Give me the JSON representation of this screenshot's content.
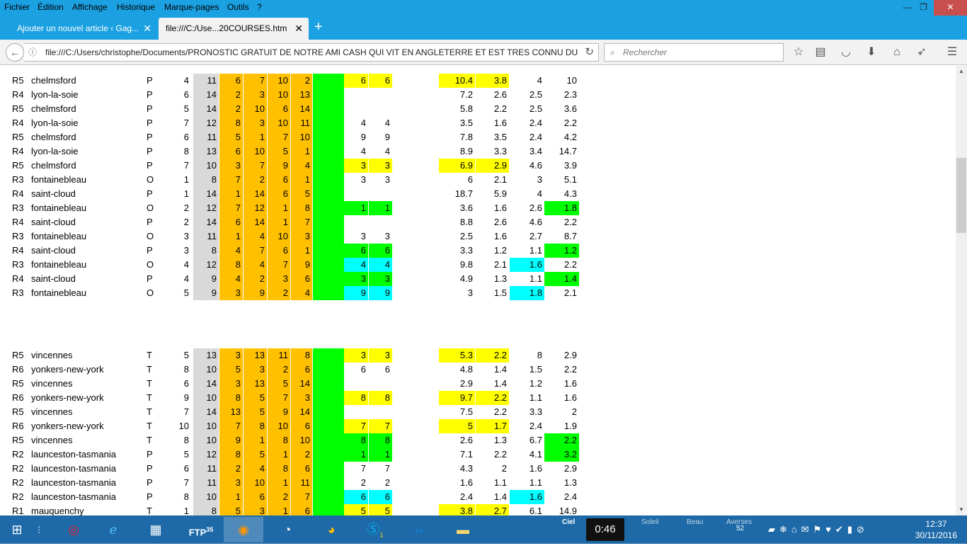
{
  "menubar": {
    "items": [
      "Fichier",
      "Édition",
      "Affichage",
      "Historique",
      "Marque-pages",
      "Outils",
      "?"
    ],
    "minimize": "—",
    "maximize": "❐",
    "close": "✕"
  },
  "tabs": [
    {
      "title": "Ajouter un nouvel article ‹ Gag..."
    },
    {
      "title": "file:///C:/Use...20COURSES.htm"
    }
  ],
  "navbar": {
    "url": "file:///C:/Users/christophe/Documents/PRONOSTIC GRATUIT DE NOTRE AMI CASH QUI VIT EN ANGLETERRE ET EST TRES CONNU DU M",
    "search_placeholder": "Rechercher"
  },
  "colors": {
    "orange": "#ffc000",
    "green": "#00ff00",
    "yellow": "#ffff00",
    "cyan": "#00ffff",
    "gray": "#d9d9d9"
  },
  "table1": [
    {
      "r": "R5",
      "track": "chelmsford",
      "t": "P",
      "a": "4",
      "b": "11",
      "o": [
        "6",
        "7",
        "10",
        "2"
      ],
      "p": [
        "6",
        "6"
      ],
      "pc": "yellow",
      "v": [
        "10.4",
        "3.8",
        "4",
        "10"
      ],
      "vc": [
        "yellow",
        "yellow",
        "",
        ""
      ]
    },
    {
      "r": "R4",
      "track": "lyon-la-soie",
      "t": "P",
      "a": "6",
      "b": "14",
      "o": [
        "2",
        "3",
        "10",
        "13"
      ],
      "p": [
        "",
        ""
      ],
      "pc": "",
      "v": [
        "7.2",
        "2.6",
        "2.5",
        "2.3"
      ],
      "vc": [
        "",
        "",
        "",
        ""
      ]
    },
    {
      "r": "R5",
      "track": "chelmsford",
      "t": "P",
      "a": "5",
      "b": "14",
      "o": [
        "2",
        "10",
        "6",
        "14"
      ],
      "p": [
        "",
        ""
      ],
      "pc": "",
      "v": [
        "5.8",
        "2.2",
        "2.5",
        "3.6"
      ],
      "vc": [
        "",
        "",
        "",
        ""
      ]
    },
    {
      "r": "R4",
      "track": "lyon-la-soie",
      "t": "P",
      "a": "7",
      "b": "12",
      "o": [
        "8",
        "3",
        "10",
        "11"
      ],
      "p": [
        "4",
        "4"
      ],
      "pc": "",
      "v": [
        "3.5",
        "1.6",
        "2.4",
        "2.2"
      ],
      "vc": [
        "",
        "",
        "",
        ""
      ]
    },
    {
      "r": "R5",
      "track": "chelmsford",
      "t": "P",
      "a": "6",
      "b": "11",
      "o": [
        "5",
        "1",
        "7",
        "10"
      ],
      "p": [
        "9",
        "9"
      ],
      "pc": "",
      "v": [
        "7.8",
        "3.5",
        "2.4",
        "4.2"
      ],
      "vc": [
        "",
        "",
        "",
        ""
      ]
    },
    {
      "r": "R4",
      "track": "lyon-la-soie",
      "t": "P",
      "a": "8",
      "b": "13",
      "o": [
        "6",
        "10",
        "5",
        "1"
      ],
      "p": [
        "4",
        "4"
      ],
      "pc": "",
      "v": [
        "8.9",
        "3.3",
        "3.4",
        "14.7"
      ],
      "vc": [
        "",
        "",
        "",
        ""
      ]
    },
    {
      "r": "R5",
      "track": "chelmsford",
      "t": "P",
      "a": "7",
      "b": "10",
      "o": [
        "3",
        "7",
        "9",
        "4"
      ],
      "p": [
        "3",
        "3"
      ],
      "pc": "yellow",
      "v": [
        "6.9",
        "2.9",
        "4.6",
        "3.9"
      ],
      "vc": [
        "yellow",
        "yellow",
        "",
        ""
      ]
    },
    {
      "r": "R3",
      "track": "fontainebleau",
      "t": "O",
      "a": "1",
      "b": "8",
      "o": [
        "7",
        "2",
        "6",
        "1"
      ],
      "p": [
        "3",
        "3"
      ],
      "pc": "",
      "v": [
        "6",
        "2.1",
        "3",
        "5.1"
      ],
      "vc": [
        "",
        "",
        "",
        ""
      ]
    },
    {
      "r": "R4",
      "track": "saint-cloud",
      "t": "P",
      "a": "1",
      "b": "14",
      "o": [
        "1",
        "14",
        "6",
        "5"
      ],
      "p": [
        "",
        ""
      ],
      "pc": "",
      "v": [
        "18.7",
        "5.9",
        "4",
        "4.3"
      ],
      "vc": [
        "",
        "",
        "",
        ""
      ]
    },
    {
      "r": "R3",
      "track": "fontainebleau",
      "t": "O",
      "a": "2",
      "b": "12",
      "o": [
        "7",
        "12",
        "1",
        "8"
      ],
      "p": [
        "1",
        "1"
      ],
      "pc": "green",
      "v": [
        "3.6",
        "1.6",
        "2.6",
        "1.8"
      ],
      "vc": [
        "",
        "",
        "",
        "green"
      ]
    },
    {
      "r": "R4",
      "track": "saint-cloud",
      "t": "P",
      "a": "2",
      "b": "14",
      "o": [
        "6",
        "14",
        "1",
        "7"
      ],
      "p": [
        "",
        ""
      ],
      "pc": "",
      "v": [
        "8.8",
        "2.6",
        "4.6",
        "2.2"
      ],
      "vc": [
        "",
        "",
        "",
        ""
      ]
    },
    {
      "r": "R3",
      "track": "fontainebleau",
      "t": "O",
      "a": "3",
      "b": "11",
      "o": [
        "1",
        "4",
        "10",
        "3"
      ],
      "p": [
        "3",
        "3"
      ],
      "pc": "",
      "v": [
        "2.5",
        "1.6",
        "2.7",
        "8.7"
      ],
      "vc": [
        "",
        "",
        "",
        ""
      ]
    },
    {
      "r": "R4",
      "track": "saint-cloud",
      "t": "P",
      "a": "3",
      "b": "8",
      "o": [
        "4",
        "7",
        "6",
        "1"
      ],
      "p": [
        "6",
        "6"
      ],
      "pc": "green",
      "v": [
        "3.3",
        "1.2",
        "1.1",
        "1.2"
      ],
      "vc": [
        "",
        "",
        "",
        "green"
      ]
    },
    {
      "r": "R3",
      "track": "fontainebleau",
      "t": "O",
      "a": "4",
      "b": "12",
      "o": [
        "8",
        "4",
        "7",
        "9"
      ],
      "p": [
        "4",
        "4"
      ],
      "pc": "cyan",
      "v": [
        "9.8",
        "2.1",
        "1.6",
        "2.2"
      ],
      "vc": [
        "",
        "",
        "cyan",
        ""
      ]
    },
    {
      "r": "R4",
      "track": "saint-cloud",
      "t": "P",
      "a": "4",
      "b": "9",
      "o": [
        "4",
        "2",
        "3",
        "6"
      ],
      "p": [
        "3",
        "3"
      ],
      "pc": "green",
      "v": [
        "4.9",
        "1.3",
        "1.1",
        "1.4"
      ],
      "vc": [
        "",
        "",
        "",
        "green"
      ]
    },
    {
      "r": "R3",
      "track": "fontainebleau",
      "t": "O",
      "a": "5",
      "b": "9",
      "o": [
        "3",
        "9",
        "2",
        "4"
      ],
      "p": [
        "9",
        "9"
      ],
      "pc": "cyan",
      "v": [
        "3",
        "1.5",
        "1.8",
        "2.1"
      ],
      "vc": [
        "",
        "",
        "cyan",
        ""
      ]
    }
  ],
  "table2": [
    {
      "r": "R5",
      "track": "vincennes",
      "t": "T",
      "a": "5",
      "b": "13",
      "o": [
        "3",
        "13",
        "11",
        "8"
      ],
      "p": [
        "3",
        "3"
      ],
      "pc": "yellow",
      "v": [
        "5.3",
        "2.2",
        "8",
        "2.9"
      ],
      "vc": [
        "yellow",
        "yellow",
        "",
        ""
      ]
    },
    {
      "r": "R6",
      "track": "yonkers-new-york",
      "t": "T",
      "a": "8",
      "b": "10",
      "o": [
        "5",
        "3",
        "2",
        "6"
      ],
      "p": [
        "6",
        "6"
      ],
      "pc": "",
      "v": [
        "4.8",
        "1.4",
        "1.5",
        "2.2"
      ],
      "vc": [
        "",
        "",
        "",
        ""
      ]
    },
    {
      "r": "R5",
      "track": "vincennes",
      "t": "T",
      "a": "6",
      "b": "14",
      "o": [
        "3",
        "13",
        "5",
        "14"
      ],
      "p": [
        "",
        ""
      ],
      "pc": "",
      "v": [
        "2.9",
        "1.4",
        "1.2",
        "1.6"
      ],
      "vc": [
        "",
        "",
        "",
        ""
      ]
    },
    {
      "r": "R6",
      "track": "yonkers-new-york",
      "t": "T",
      "a": "9",
      "b": "10",
      "o": [
        "8",
        "5",
        "7",
        "3"
      ],
      "p": [
        "8",
        "8"
      ],
      "pc": "yellow",
      "v": [
        "9.7",
        "2.2",
        "1.1",
        "1.6"
      ],
      "vc": [
        "yellow",
        "yellow",
        "",
        ""
      ]
    },
    {
      "r": "R5",
      "track": "vincennes",
      "t": "T",
      "a": "7",
      "b": "14",
      "o": [
        "13",
        "5",
        "9",
        "14"
      ],
      "p": [
        "",
        ""
      ],
      "pc": "",
      "v": [
        "7.5",
        "2.2",
        "3.3",
        "2"
      ],
      "vc": [
        "",
        "",
        "",
        ""
      ]
    },
    {
      "r": "R6",
      "track": "yonkers-new-york",
      "t": "T",
      "a": "10",
      "b": "10",
      "o": [
        "7",
        "8",
        "10",
        "6"
      ],
      "p": [
        "7",
        "7"
      ],
      "pc": "yellow",
      "v": [
        "5",
        "1.7",
        "2.4",
        "1.9"
      ],
      "vc": [
        "yellow",
        "yellow",
        "",
        ""
      ]
    },
    {
      "r": "R5",
      "track": "vincennes",
      "t": "T",
      "a": "8",
      "b": "10",
      "o": [
        "9",
        "1",
        "8",
        "10"
      ],
      "p": [
        "8",
        "8"
      ],
      "pc": "green",
      "v": [
        "2.6",
        "1.3",
        "6.7",
        "2.2"
      ],
      "vc": [
        "",
        "",
        "",
        "green"
      ]
    },
    {
      "r": "R2",
      "track": "launceston-tasmania",
      "t": "P",
      "a": "5",
      "b": "12",
      "o": [
        "8",
        "5",
        "1",
        "2"
      ],
      "p": [
        "1",
        "1"
      ],
      "pc": "green",
      "v": [
        "7.1",
        "2.2",
        "4.1",
        "3.2"
      ],
      "vc": [
        "",
        "",
        "",
        "green"
      ]
    },
    {
      "r": "R2",
      "track": "launceston-tasmania",
      "t": "P",
      "a": "6",
      "b": "11",
      "o": [
        "2",
        "4",
        "8",
        "6"
      ],
      "p": [
        "7",
        "7"
      ],
      "pc": "",
      "v": [
        "4.3",
        "2",
        "1.6",
        "2.9"
      ],
      "vc": [
        "",
        "",
        "",
        ""
      ]
    },
    {
      "r": "R2",
      "track": "launceston-tasmania",
      "t": "P",
      "a": "7",
      "b": "11",
      "o": [
        "3",
        "10",
        "1",
        "11"
      ],
      "p": [
        "2",
        "2"
      ],
      "pc": "",
      "v": [
        "1.6",
        "1.1",
        "1.1",
        "1.3"
      ],
      "vc": [
        "",
        "",
        "",
        ""
      ]
    },
    {
      "r": "R2",
      "track": "launceston-tasmania",
      "t": "P",
      "a": "8",
      "b": "10",
      "o": [
        "1",
        "6",
        "2",
        "7"
      ],
      "p": [
        "6",
        "6"
      ],
      "pc": "cyan",
      "v": [
        "2.4",
        "1.4",
        "1.6",
        "2.4"
      ],
      "vc": [
        "",
        "",
        "cyan",
        ""
      ]
    },
    {
      "r": "R1",
      "track": "mauquenchy",
      "t": "T",
      "a": "1",
      "b": "8",
      "o": [
        "5",
        "3",
        "1",
        "6"
      ],
      "p": [
        "5",
        "5"
      ],
      "pc": "yellow",
      "v": [
        "3.8",
        "2.7",
        "6.1",
        "14.9"
      ],
      "vc": [
        "yellow",
        "yellow",
        "",
        ""
      ]
    }
  ],
  "taskbar": {
    "apps": [
      "windows-start",
      "task-view",
      "opera",
      "internet-explorer",
      "file-manager",
      "ftp",
      "firefox",
      "speedometer",
      "chrome",
      "skype",
      "teamviewer",
      "folder"
    ],
    "ftp_badge": "35",
    "skype_badge": "1",
    "weather": {
      "ciel": "Ciel",
      "soleil": "Soleil",
      "beau": "Beau",
      "averses": "Averses"
    },
    "timer": "0:46",
    "tray_temp": "52",
    "clock_time": "12:37",
    "clock_date": "30/11/2016"
  }
}
